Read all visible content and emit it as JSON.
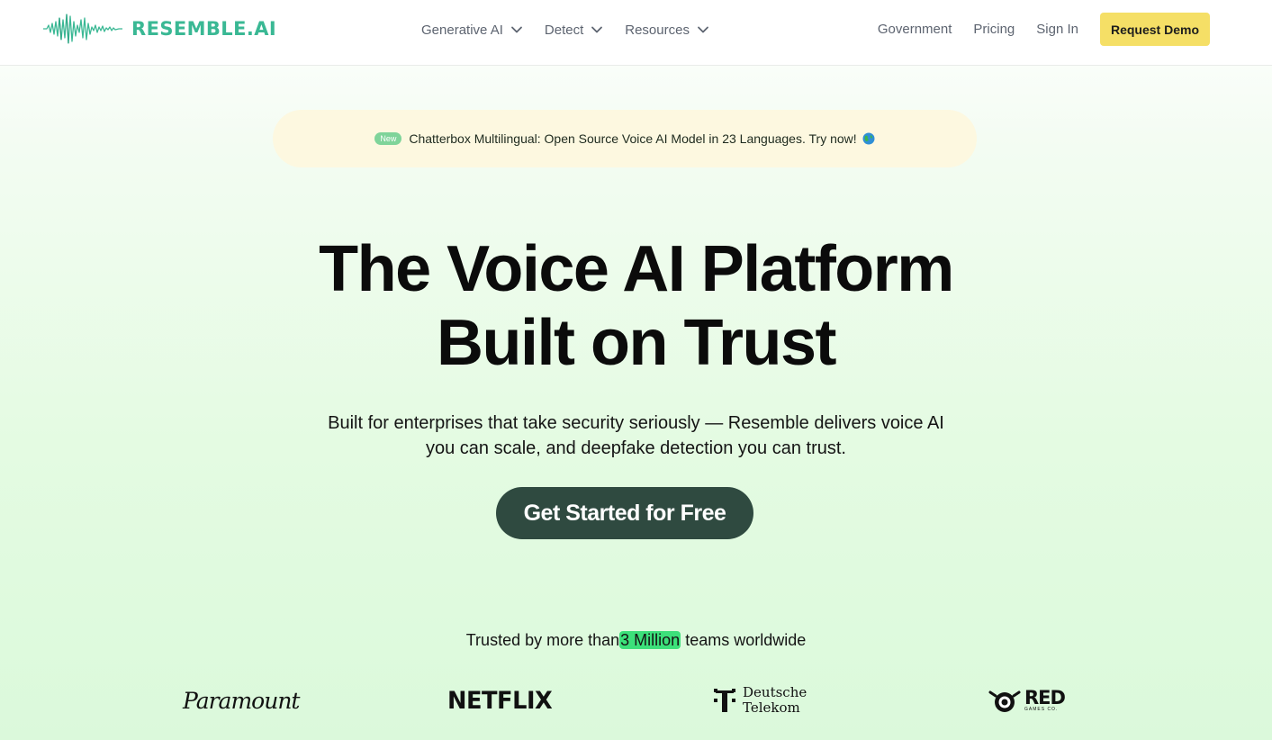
{
  "header": {
    "brand": "RESEMBLE.AI",
    "nav": [
      {
        "label": "Generative AI",
        "icon": "chevron-down-icon"
      },
      {
        "label": "Detect",
        "icon": "chevron-down-icon"
      },
      {
        "label": "Resources",
        "icon": "chevron-down-icon"
      }
    ],
    "links": [
      "Government",
      "Pricing",
      "Sign In"
    ],
    "cta": "Request Demo"
  },
  "announcement": {
    "badge": "New",
    "text": "Chatterbox Multilingual: Open Source Voice AI Model in 23 Languages. Try now!",
    "icon": "globe-icon"
  },
  "hero": {
    "title_line1": "The Voice AI Platform",
    "title_line2": "Built on Trust",
    "subtitle_line1": "Built for enterprises that take security seriously — Resemble delivers voice AI",
    "subtitle_line2": "you can scale, and deepfake detection you can trust.",
    "cta": "Get Started for Free"
  },
  "trusted": {
    "prefix": "Trusted by more than",
    "highlight": "3 Million",
    "suffix": " teams worldwide"
  },
  "logos": {
    "paramount": "Paramount",
    "netflix": "NETFLIX",
    "telekom_line1": "Deutsche",
    "telekom_line2": "Telekom",
    "redgames_main": "RED",
    "redgames_sub": "GAMES CO."
  },
  "colors": {
    "brand_green": "#3ab894",
    "cta_dark": "#2f4a40",
    "demo_yellow": "#f5df66",
    "highlight_green": "#3ce07a",
    "announce_bg": "#fdf8e0"
  }
}
